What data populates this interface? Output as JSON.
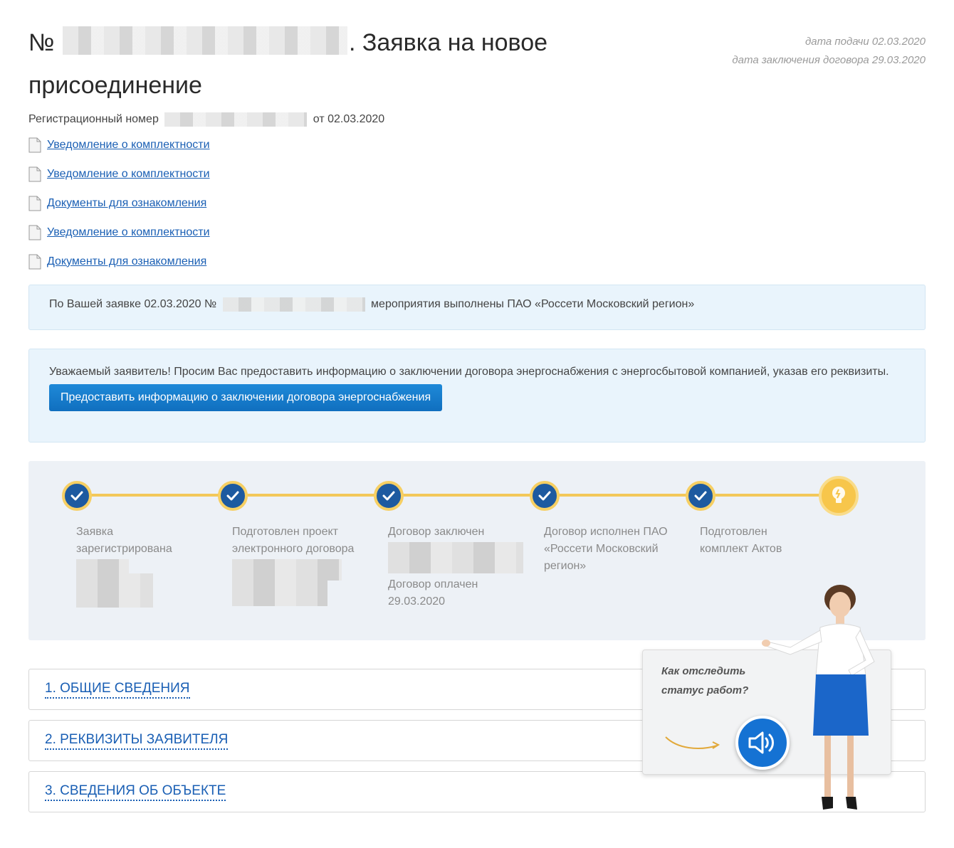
{
  "header": {
    "title_prefix": "№",
    "title_suffix": ". Заявка на новое присоединение",
    "date_submitted": "дата подачи 02.03.2020",
    "date_contract": "дата заключения договора 29.03.2020"
  },
  "registration": {
    "label": "Регистрационный номер",
    "date": "от 02.03.2020"
  },
  "documents": [
    {
      "label": "Уведомление о комплектности"
    },
    {
      "label": "Уведомление о комплектности"
    },
    {
      "label": "Документы для ознакомления"
    },
    {
      "label": "Уведомление о комплектности"
    },
    {
      "label": "Документы для ознакомления"
    }
  ],
  "notice": {
    "prefix": "По Вашей заявке 02.03.2020 №",
    "suffix": "мероприятия выполнены ПАО «Россети Московский регион»"
  },
  "request": {
    "text": "Уважаемый заявитель! Просим Вас предоставить информацию о заключении договора энергоснабжения с энергосбытовой компанией, указав его реквизиты.",
    "button_label": "Предоставить информацию о заключении договора энергоснабжения"
  },
  "steps": [
    {
      "label": "Заявка зарегистрирована",
      "done": true
    },
    {
      "label": "Подготовлен проект электронного договора",
      "done": true
    },
    {
      "label": "Договор заключен",
      "extra": "Договор оплачен 29.03.2020",
      "done": true
    },
    {
      "label": "Договор исполнен ПАО «Россети Московский регион»",
      "done": true
    },
    {
      "label": "Подготовлен комплект Актов",
      "done": true
    },
    {
      "label": "",
      "done": false,
      "icon": "lightbulb-icon"
    }
  ],
  "sections": [
    {
      "label": "1. ОБЩИЕ СВЕДЕНИЯ"
    },
    {
      "label": "2. РЕКВИЗИТЫ ЗАЯВИТЕЛЯ"
    },
    {
      "label": "3. СВЕДЕНИЯ ОБ ОБЪЕКТЕ"
    }
  ],
  "help": {
    "text": "Как отследить статус работ?",
    "icon": "speaker-icon"
  },
  "colors": {
    "link": "#1a5fb4",
    "accent_blue": "#1d5aa0",
    "accent_yellow": "#f3c85a",
    "info_bg": "#e9f4fc",
    "button": "#1572d3"
  }
}
